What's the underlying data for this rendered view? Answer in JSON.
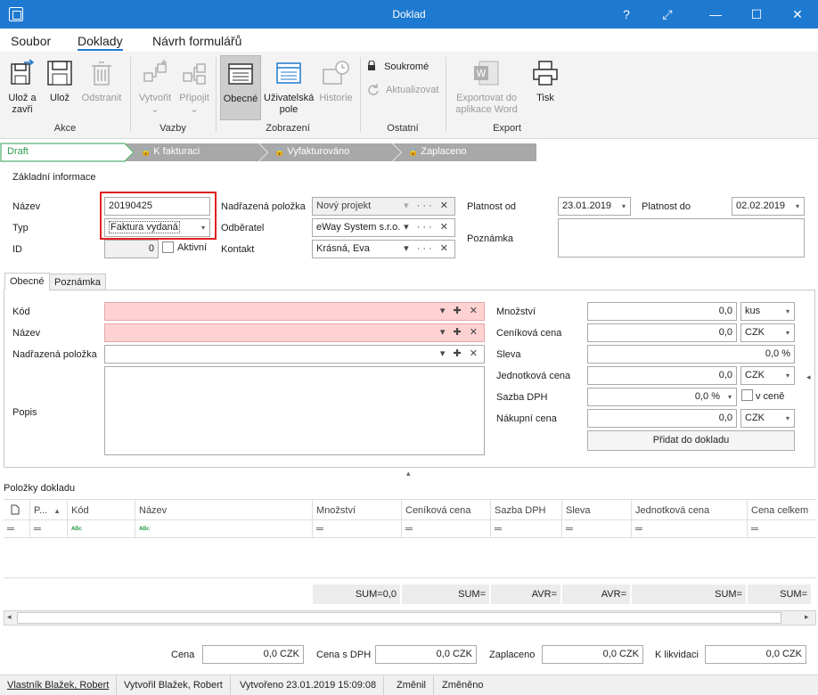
{
  "window": {
    "title": "Doklad",
    "buttons": {
      "help": "?",
      "restore": "⤢",
      "minimize": "—",
      "maximize": "☐",
      "close": "✕"
    }
  },
  "ribbon_tabs": [
    "Soubor",
    "Doklady",
    "Návrh formulářů"
  ],
  "ribbon": {
    "akce": {
      "label": "Akce",
      "save_close": "Ulož a\nzavři",
      "save": "Ulož",
      "delete": "Odstranit"
    },
    "vazby": {
      "label": "Vazby",
      "create": "Vytvořit",
      "attach": "Připojit",
      "chevron": "⌄"
    },
    "zobrazeni": {
      "label": "Zobrazení",
      "general": "Obecné",
      "user_fields": "Uživatelská\npole",
      "history": "Historie"
    },
    "ostatni": {
      "label": "Ostatní",
      "private": "Soukromé",
      "update": "Aktualizovat"
    },
    "export": {
      "label": "Export",
      "export_word": "Exportovat do\naplikace Word",
      "print": "Tisk"
    }
  },
  "workflow": {
    "states": [
      "Draft",
      "K fakturaci",
      "Vyfakturováno",
      "Zaplaceno"
    ],
    "lock": "🔒"
  },
  "basic_info": {
    "section_title": "Základní informace",
    "name_label": "Název",
    "name_value": "20190425",
    "type_label": "Typ",
    "type_value": "Faktura vydaná",
    "id_label": "ID",
    "id_value": "0",
    "active_label": "Aktivní",
    "parent_label": "Nadřazená položka",
    "parent_value": "Nový projekt",
    "customer_label": "Odběratel",
    "customer_value": "eWay System s.r.o.",
    "contact_label": "Kontakt",
    "contact_value": "Krásná, Eva",
    "valid_from_label": "Platnost od",
    "valid_from_value": "23.01.2019",
    "valid_to_label": "Platnost do",
    "valid_to_value": "02.02.2019",
    "note_label": "Poznámka"
  },
  "icons": {
    "dropdown": "▾",
    "ellipsis": "···",
    "clear": "✕",
    "plus": "✚",
    "splitter_up": "▴",
    "splitter_left": "◂",
    "scroll_left": "◂",
    "scroll_right": "▸",
    "sort_up": "▲",
    "filter": "═",
    "abc": "ᴬᴮᶜ"
  },
  "item_tabs": [
    "Obecné",
    "Poznámka"
  ],
  "item_form": {
    "code_label": "Kód",
    "name_label": "Název",
    "parent_label": "Nadřazená položka",
    "desc_label": "Popis",
    "qty_label": "Množství",
    "qty_value": "0,0",
    "qty_unit": "kus",
    "list_price_label": "Ceníková cena",
    "list_price_value": "0,0",
    "list_price_cur": "CZK",
    "discount_label": "Sleva",
    "discount_value": "0,0 %",
    "unit_price_label": "Jednotková cena",
    "unit_price_value": "0,0",
    "unit_price_cur": "CZK",
    "vat_label": "Sazba DPH",
    "vat_value": "0,0 %",
    "vat_incl_label": "v ceně",
    "purchase_label": "Nákupní cena",
    "purchase_value": "0,0",
    "purchase_cur": "CZK",
    "add_button": "Přidat do dokladu"
  },
  "items_grid": {
    "title": "Položky dokladu",
    "columns": [
      "P...",
      "Kód",
      "Název",
      "Množství",
      "Ceníková cena",
      "Sazba DPH",
      "Sleva",
      "Jednotková cena",
      "Cena celkem"
    ],
    "sums": [
      "SUM=0,0",
      "SUM=",
      "AVR=",
      "AVR=",
      "SUM=",
      "SUM="
    ]
  },
  "totals": {
    "price_label": "Cena",
    "price_value": "0,0 CZK",
    "price_vat_label": "Cena s DPH",
    "price_vat_value": "0,0 CZK",
    "paid_label": "Zaplaceno",
    "paid_value": "0,0 CZK",
    "to_pay_label": "K likvidaci",
    "to_pay_value": "0,0 CZK"
  },
  "status": {
    "owner": "Vlastník Blažek, Robert",
    "created_by": "Vytvořil Blažek, Robert",
    "created": "Vytvořeno 23.01.2019 15:09:08",
    "changed_by": "Změnil",
    "changed": "Změněno"
  },
  "colors": {
    "titlebar": "#1e79d0",
    "draft": "#2e9e4f",
    "locked": "#a8a8a8",
    "required": "#ffd2d2",
    "highlight": "#e02020"
  }
}
